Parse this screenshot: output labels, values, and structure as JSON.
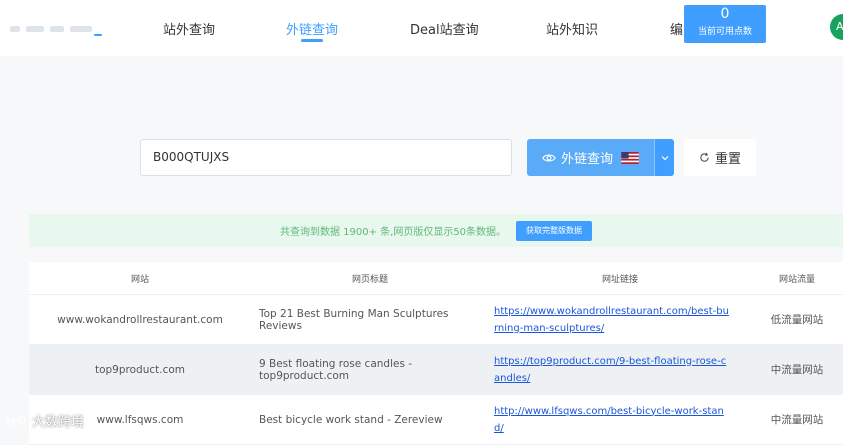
{
  "nav": {
    "items": [
      "站外查询",
      "外链查询",
      "Deal站查询",
      "站外知识",
      "编"
    ],
    "active_index": 1
  },
  "points": {
    "value": "0",
    "label": "当前可用点数"
  },
  "avatar": {
    "text": "A"
  },
  "search": {
    "value": "B000QTUJXS",
    "query_button_label": "外链查询",
    "reset_button_label": "重置",
    "flag": "us-flag-icon"
  },
  "info": {
    "text": "共查询到数据 1900+ 条,网页版仅显示50条数据。",
    "button_label": "获取完整版数据"
  },
  "table": {
    "headers": [
      "网站",
      "网页标题",
      "网址链接",
      "网站流量"
    ],
    "rows": [
      {
        "site": "www.wokandrollrestaurant.com",
        "title": "Top 21 Best Burning Man Sculptures Reviews",
        "url": "https://www.wokandrollrestaurant.com/best-burning-man-sculptures/",
        "traffic": "低流量网站"
      },
      {
        "site": "top9product.com",
        "title": "9 Best floating rose candles - top9product.com",
        "url": "https://top9product.com/9-best-floating-rose-candles/",
        "traffic": "中流量网站"
      },
      {
        "site": "www.lfsqws.com",
        "title": "Best bicycle work stand - Zereview",
        "url": "http://www.lfsqws.com/best-bicycle-work-stand/",
        "traffic": "中流量网站"
      }
    ]
  },
  "watermark": {
    "text": "大数跨境"
  },
  "colors": {
    "primary": "#409eff",
    "success_bg": "#e8f8ee",
    "success_text": "#5fb878"
  }
}
